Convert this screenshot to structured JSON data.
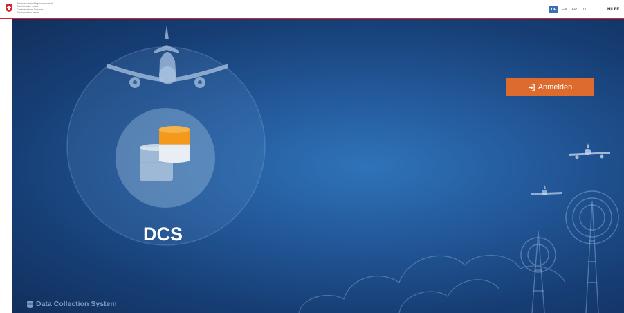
{
  "header": {
    "federal_lines": [
      "Schweizerische Eidgenossenschaft",
      "Confédération suisse",
      "Confederazione Svizzera",
      "Confederaziun svizra"
    ],
    "languages": [
      "DE",
      "EN",
      "FR",
      "IT"
    ],
    "active_language": "DE",
    "help_label": "HILFE"
  },
  "hero": {
    "app_short_name": "DCS",
    "login_label": "Anmelden"
  },
  "footer": {
    "app_full_name": "Data Collection System"
  },
  "colors": {
    "accent": "#de6b2e",
    "active_lang": "#3c6fb7",
    "swiss_red": "#d8232a",
    "db_orange": "#f39a1c"
  },
  "icons": {
    "crest": "swiss-cross-icon",
    "login": "sign-in-icon",
    "database": "database-icon"
  }
}
